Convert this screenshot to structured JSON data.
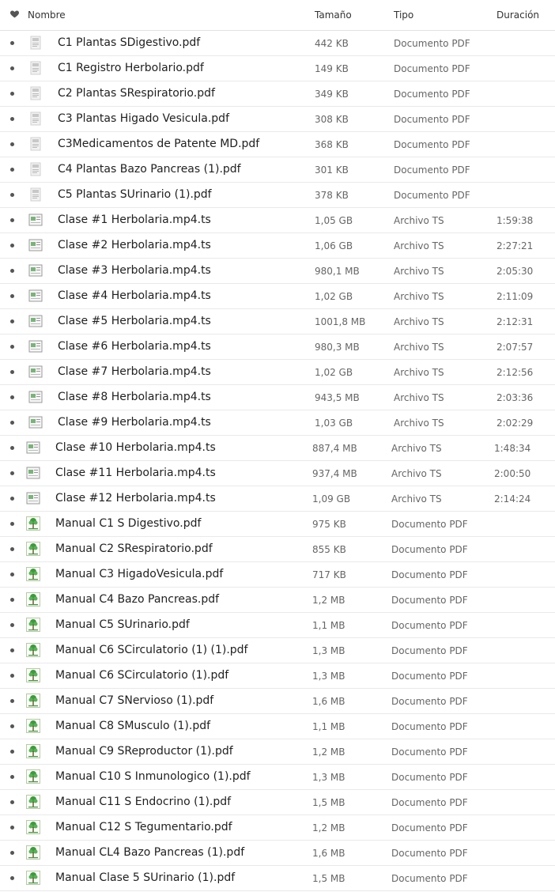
{
  "header": {
    "name": "Nombre",
    "size": "Tamaño",
    "type": "Tipo",
    "duration": "Duración"
  },
  "icons": {
    "heart": "heart-icon",
    "pdf_thumb": "document-thumbnail-icon",
    "video_thumb": "video-thumbnail-icon",
    "tree_thumb": "tree-thumbnail-icon"
  },
  "files": [
    {
      "name": "C1 Plantas SDigestivo.pdf",
      "size": "442 KB",
      "type": "Documento PDF",
      "duration": "",
      "thumb": "pdf"
    },
    {
      "name": "C1 Registro Herbolario.pdf",
      "size": "149 KB",
      "type": "Documento PDF",
      "duration": "",
      "thumb": "pdf"
    },
    {
      "name": "C2 Plantas SRespiratorio.pdf",
      "size": "349 KB",
      "type": "Documento PDF",
      "duration": "",
      "thumb": "pdf"
    },
    {
      "name": "C3 Plantas Higado Vesicula.pdf",
      "size": "308 KB",
      "type": "Documento PDF",
      "duration": "",
      "thumb": "pdf"
    },
    {
      "name": "C3Medicamentos de Patente MD.pdf",
      "size": "368 KB",
      "type": "Documento PDF",
      "duration": "",
      "thumb": "pdf"
    },
    {
      "name": "C4 Plantas Bazo Pancreas (1).pdf",
      "size": "301 KB",
      "type": "Documento PDF",
      "duration": "",
      "thumb": "pdf"
    },
    {
      "name": "C5 Plantas SUrinario (1).pdf",
      "size": "378 KB",
      "type": "Documento PDF",
      "duration": "",
      "thumb": "pdf"
    },
    {
      "name": "Clase #1 Herbolaria.mp4.ts",
      "size": "1,05 GB",
      "type": "Archivo TS",
      "duration": "1:59:38",
      "thumb": "video"
    },
    {
      "name": "Clase #2 Herbolaria.mp4.ts",
      "size": "1,06 GB",
      "type": "Archivo TS",
      "duration": "2:27:21",
      "thumb": "video"
    },
    {
      "name": "Clase #3 Herbolaria.mp4.ts",
      "size": "980,1 MB",
      "type": "Archivo TS",
      "duration": "2:05:30",
      "thumb": "video"
    },
    {
      "name": "Clase #4 Herbolaria.mp4.ts",
      "size": "1,02 GB",
      "type": "Archivo TS",
      "duration": "2:11:09",
      "thumb": "video"
    },
    {
      "name": "Clase #5 Herbolaria.mp4.ts",
      "size": "1001,8 MB",
      "type": "Archivo TS",
      "duration": "2:12:31",
      "thumb": "video"
    },
    {
      "name": "Clase #6 Herbolaria.mp4.ts",
      "size": "980,3 MB",
      "type": "Archivo TS",
      "duration": "2:07:57",
      "thumb": "video"
    },
    {
      "name": "Clase #7 Herbolaria.mp4.ts",
      "size": "1,02 GB",
      "type": "Archivo TS",
      "duration": "2:12:56",
      "thumb": "video"
    },
    {
      "name": "Clase #8 Herbolaria.mp4.ts",
      "size": "943,5 MB",
      "type": "Archivo TS",
      "duration": "2:03:36",
      "thumb": "video"
    },
    {
      "name": "Clase #9 Herbolaria.mp4.ts",
      "size": "1,03 GB",
      "type": "Archivo TS",
      "duration": "2:02:29",
      "thumb": "video"
    },
    {
      "name": "Clase #10 Herbolaria.mp4.ts",
      "size": "887,4 MB",
      "type": "Archivo TS",
      "duration": "1:48:34",
      "thumb": "video"
    },
    {
      "name": "Clase #11 Herbolaria.mp4.ts",
      "size": "937,4 MB",
      "type": "Archivo TS",
      "duration": "2:00:50",
      "thumb": "video"
    },
    {
      "name": "Clase #12 Herbolaria.mp4.ts",
      "size": "1,09 GB",
      "type": "Archivo TS",
      "duration": "2:14:24",
      "thumb": "video"
    },
    {
      "name": "Manual C1 S Digestivo.pdf",
      "size": "975 KB",
      "type": "Documento PDF",
      "duration": "",
      "thumb": "tree"
    },
    {
      "name": "Manual C2 SRespiratorio.pdf",
      "size": "855 KB",
      "type": "Documento PDF",
      "duration": "",
      "thumb": "tree"
    },
    {
      "name": "Manual C3 HigadoVesicula.pdf",
      "size": "717 KB",
      "type": "Documento PDF",
      "duration": "",
      "thumb": "tree"
    },
    {
      "name": "Manual C4 Bazo Pancreas.pdf",
      "size": "1,2 MB",
      "type": "Documento PDF",
      "duration": "",
      "thumb": "tree"
    },
    {
      "name": "Manual C5 SUrinario.pdf",
      "size": "1,1 MB",
      "type": "Documento PDF",
      "duration": "",
      "thumb": "tree"
    },
    {
      "name": "Manual C6 SCirculatorio (1) (1).pdf",
      "size": "1,3 MB",
      "type": "Documento PDF",
      "duration": "",
      "thumb": "tree"
    },
    {
      "name": "Manual C6 SCirculatorio (1).pdf",
      "size": "1,3 MB",
      "type": "Documento PDF",
      "duration": "",
      "thumb": "tree"
    },
    {
      "name": "Manual C7 SNervioso (1).pdf",
      "size": "1,6 MB",
      "type": "Documento PDF",
      "duration": "",
      "thumb": "tree"
    },
    {
      "name": "Manual C8 SMusculo (1).pdf",
      "size": "1,1 MB",
      "type": "Documento PDF",
      "duration": "",
      "thumb": "tree"
    },
    {
      "name": "Manual C9 SReproductor (1).pdf",
      "size": "1,2 MB",
      "type": "Documento PDF",
      "duration": "",
      "thumb": "tree"
    },
    {
      "name": "Manual C10 S Inmunologico (1).pdf",
      "size": "1,3 MB",
      "type": "Documento PDF",
      "duration": "",
      "thumb": "tree"
    },
    {
      "name": "Manual C11 S Endocrino (1).pdf",
      "size": "1,5 MB",
      "type": "Documento PDF",
      "duration": "",
      "thumb": "tree"
    },
    {
      "name": "Manual C12 S Tegumentario.pdf",
      "size": "1,2 MB",
      "type": "Documento PDF",
      "duration": "",
      "thumb": "tree"
    },
    {
      "name": "Manual CL4 Bazo Pancreas (1).pdf",
      "size": "1,6 MB",
      "type": "Documento PDF",
      "duration": "",
      "thumb": "tree"
    },
    {
      "name": "Manual Clase 5 SUrinario (1).pdf",
      "size": "1,5 MB",
      "type": "Documento PDF",
      "duration": "",
      "thumb": "tree"
    }
  ]
}
